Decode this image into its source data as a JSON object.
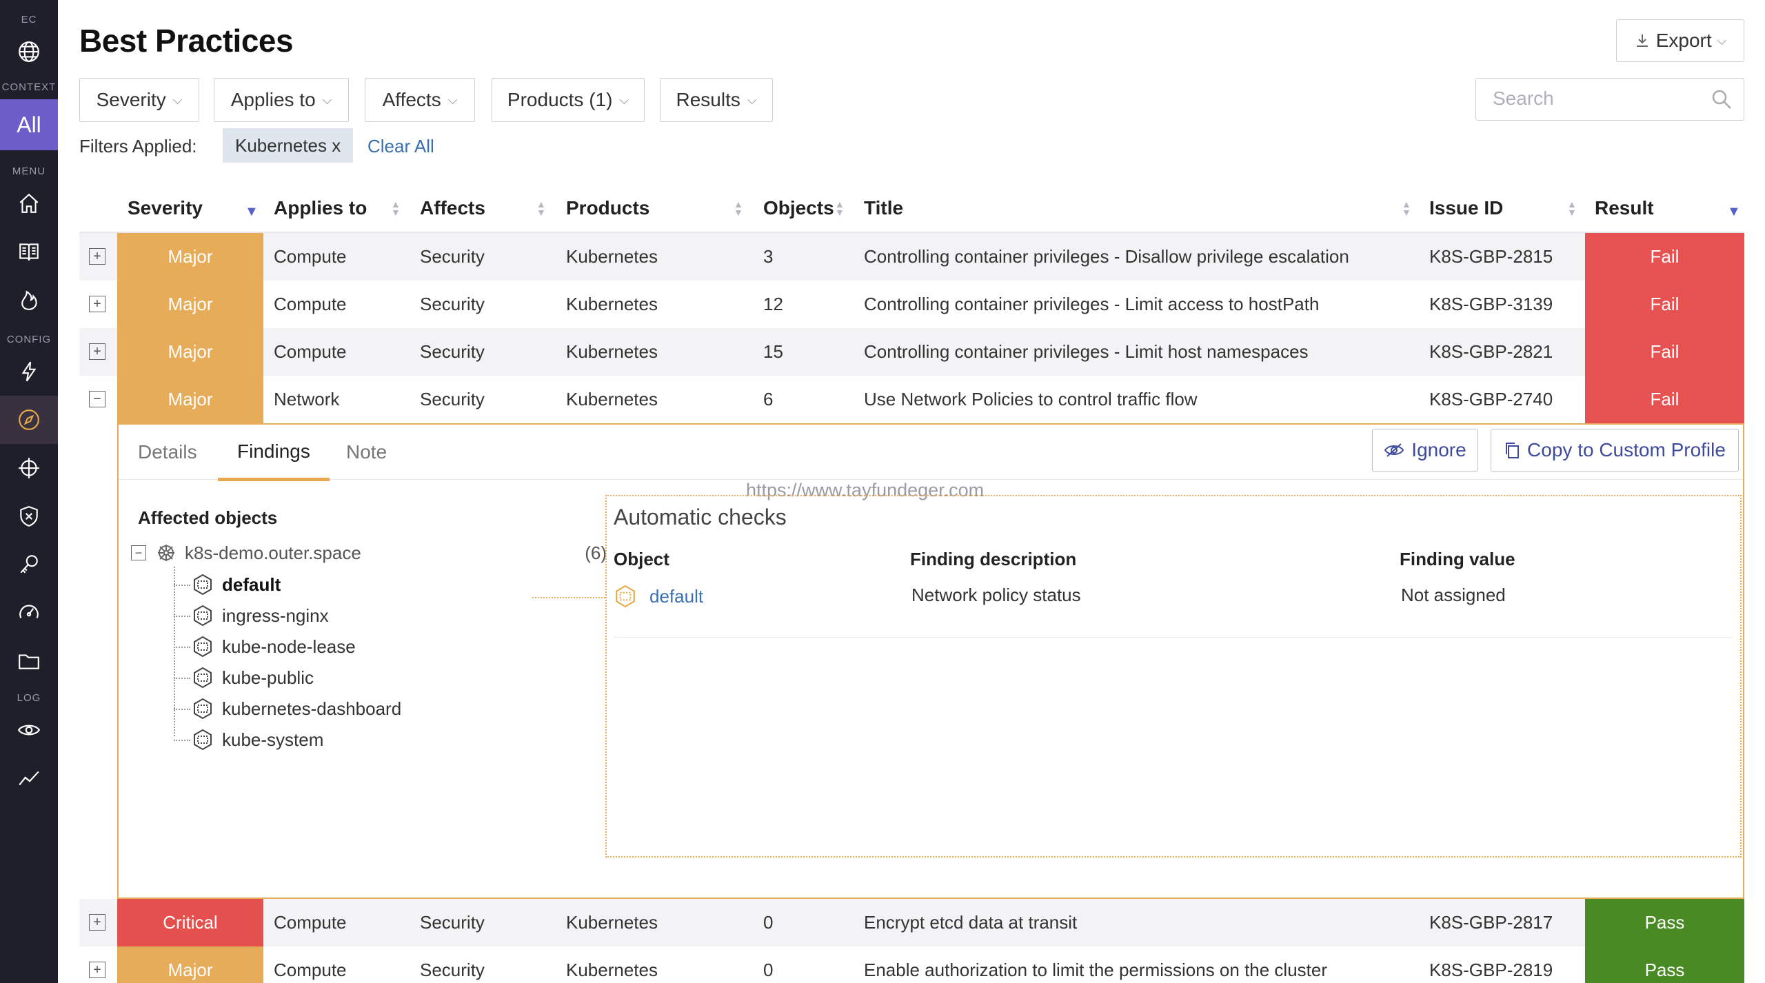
{
  "sidebar": {
    "sections": [
      "EC",
      "CONTEXT",
      "MENU",
      "CONFIG",
      "LOG"
    ],
    "context_all_label": "All",
    "icons": [
      "globe-icon",
      "home-icon",
      "book-icon",
      "fire-icon",
      "bolt-icon",
      "compass-icon",
      "crosshair-icon",
      "shield-icon",
      "key-icon",
      "gauge-icon",
      "folder-icon",
      "eye-icon",
      "trend-icon"
    ]
  },
  "page": {
    "title": "Best Practices"
  },
  "toolbar": {
    "export_label": "Export",
    "filters": [
      "Severity",
      "Applies to",
      "Affects",
      "Products (1)",
      "Results"
    ],
    "search_placeholder": "Search"
  },
  "filters_applied": {
    "label": "Filters Applied:",
    "chip": "Kubernetes x",
    "clear_all": "Clear All"
  },
  "table": {
    "columns": [
      "Severity",
      "Applies to",
      "Affects",
      "Products",
      "Objects",
      "Title",
      "Issue ID",
      "Result"
    ],
    "rows_top": [
      {
        "severity": "Major",
        "applies": "Compute",
        "affects": "Security",
        "product": "Kubernetes",
        "objects": "3",
        "title": "Controlling container privileges - Disallow privilege escalation",
        "issue": "K8S-GBP-2815",
        "result": "Fail"
      },
      {
        "severity": "Major",
        "applies": "Compute",
        "affects": "Security",
        "product": "Kubernetes",
        "objects": "12",
        "title": "Controlling container privileges - Limit access to hostPath",
        "issue": "K8S-GBP-3139",
        "result": "Fail"
      },
      {
        "severity": "Major",
        "applies": "Compute",
        "affects": "Security",
        "product": "Kubernetes",
        "objects": "15",
        "title": "Controlling container privileges - Limit host namespaces",
        "issue": "K8S-GBP-2821",
        "result": "Fail"
      },
      {
        "severity": "Major",
        "applies": "Network",
        "affects": "Security",
        "product": "Kubernetes",
        "objects": "6",
        "title": "Use Network Policies to control traffic flow",
        "issue": "K8S-GBP-2740",
        "result": "Fail"
      }
    ],
    "rows_bottom": [
      {
        "severity": "Critical",
        "applies": "Compute",
        "affects": "Security",
        "product": "Kubernetes",
        "objects": "0",
        "title": "Encrypt etcd data at transit",
        "issue": "K8S-GBP-2817",
        "result": "Pass"
      },
      {
        "severity": "Major",
        "applies": "Compute",
        "affects": "Security",
        "product": "Kubernetes",
        "objects": "0",
        "title": "Enable authorization to limit the permissions on the cluster",
        "issue": "K8S-GBP-2819",
        "result": "Pass"
      }
    ]
  },
  "detail": {
    "tabs": [
      "Details",
      "Findings",
      "Note"
    ],
    "active_tab": "Findings",
    "ignore_label": "Ignore",
    "copy_label": "Copy to Custom Profile",
    "watermark": "https://www.tayfundeger.com",
    "affected_objects_title": "Affected objects",
    "cluster_name": "k8s-demo.outer.space",
    "cluster_count": "(6)",
    "namespaces": [
      "default",
      "ingress-nginx",
      "kube-node-lease",
      "kube-public",
      "kubernetes-dashboard",
      "kube-system"
    ],
    "checks": {
      "title": "Automatic checks",
      "headers": [
        "Object",
        "Finding description",
        "Finding value"
      ],
      "row": {
        "object": "default",
        "description": "Network policy status",
        "value": "Not assigned"
      }
    }
  },
  "colors": {
    "major": "#e7ac5a",
    "critical": "#e4504e",
    "fail": "#e65151",
    "pass": "#4a8a25",
    "accent": "#6b5ec8"
  }
}
